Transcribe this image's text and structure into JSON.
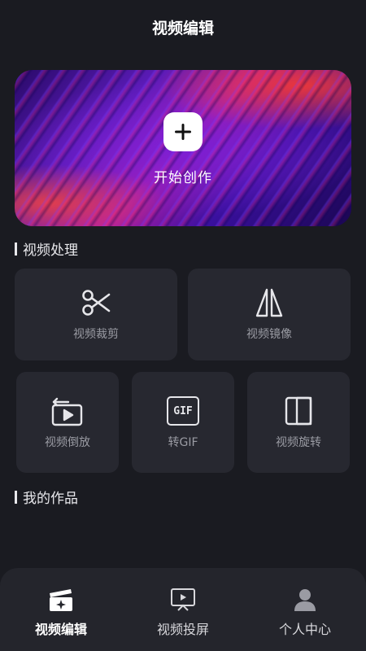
{
  "header": {
    "title": "视频编辑"
  },
  "banner": {
    "label": "开始创作"
  },
  "sections": {
    "processing": "视频处理",
    "works": "我的作品"
  },
  "tools": {
    "trim": "视频裁剪",
    "mirror": "视频镜像",
    "reverse": "视频倒放",
    "to_gif": "转GIF",
    "rotate": "视频旋转",
    "gif_badge": "GIF"
  },
  "tabs": {
    "edit": "视频编辑",
    "cast": "视频投屏",
    "profile": "个人中心"
  },
  "colors": {
    "background": "#1a1b21",
    "card": "#272830",
    "tabbar": "#24252c"
  }
}
